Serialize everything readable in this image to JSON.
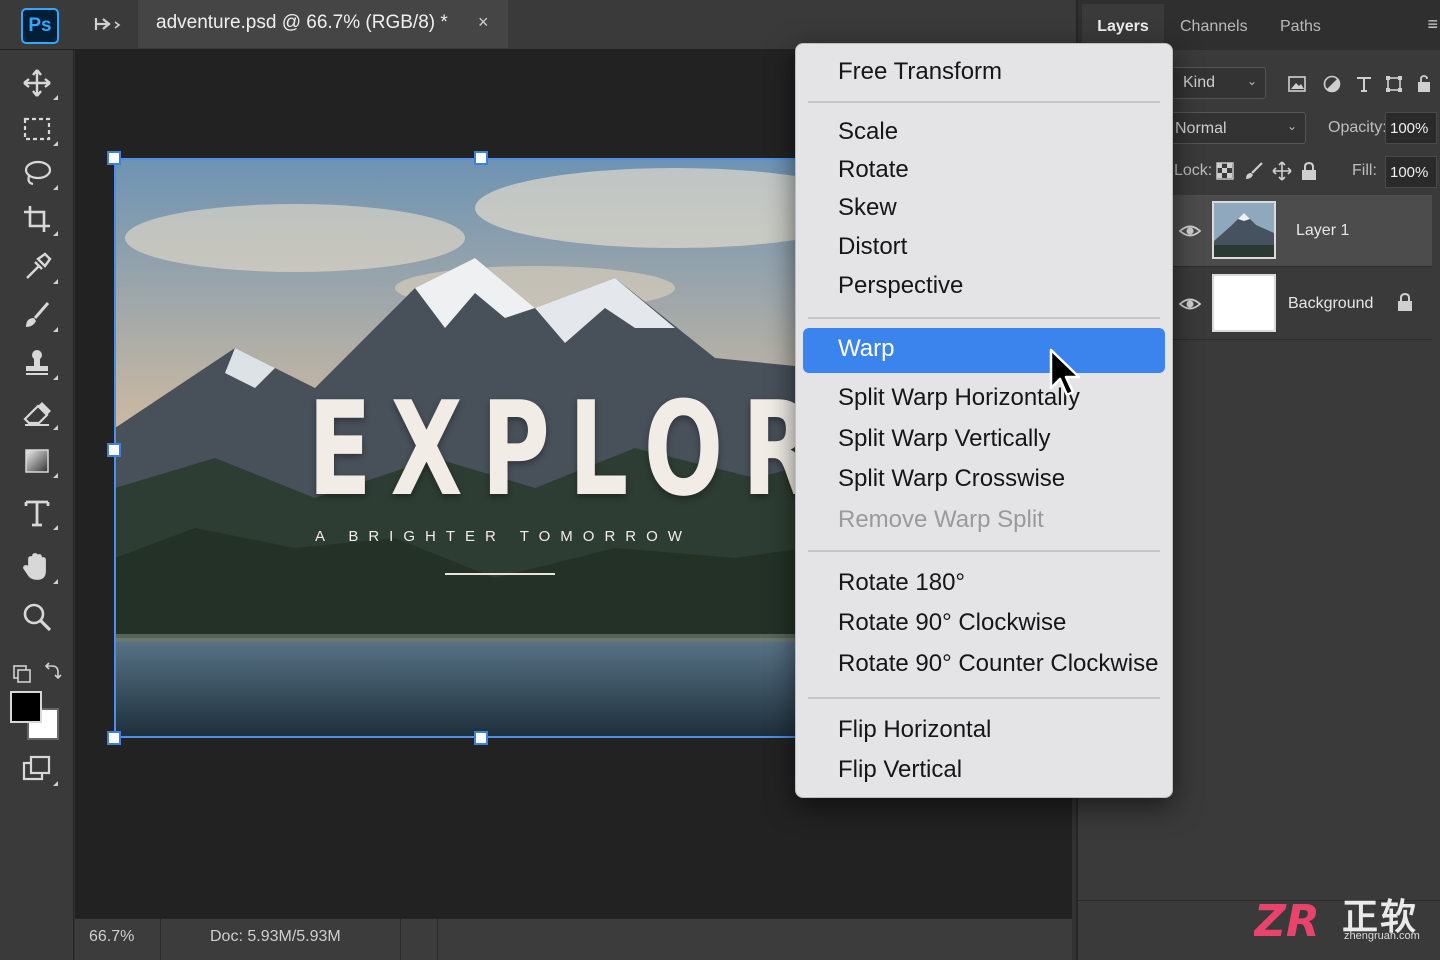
{
  "app": {
    "logo": "Ps"
  },
  "document_tab": {
    "title": "adventure.psd @ 66.7% (RGB/8) *",
    "close_glyph": "×"
  },
  "toolbar": {
    "tools": [
      "move-tool",
      "marquee-tool",
      "lasso-tool",
      "crop-tool",
      "eyedropper-tool",
      "brush-tool",
      "clone-stamp-tool",
      "eraser-tool",
      "gradient-tool",
      "type-tool",
      "hand-tool",
      "zoom-tool"
    ],
    "foreground_color": "#000000",
    "background_color": "#ffffff"
  },
  "canvas": {
    "title": "EXPLORE",
    "subtitle": "A BRIGHTER TOMORROW"
  },
  "status": {
    "zoom": "66.7%",
    "doc": "Doc: 5.93M/5.93M"
  },
  "panel": {
    "tabs": [
      "Layers",
      "Channels",
      "Paths"
    ],
    "filter_kind": "Kind",
    "blend_mode": "Normal",
    "opacity_label": "Opacity:",
    "opacity_value": "100%",
    "lock_label": "Lock:",
    "fill_label": "Fill:",
    "fill_value": "100%",
    "layers": [
      {
        "name": "Layer 1",
        "visible": true,
        "selected": true
      },
      {
        "name": "Background",
        "visible": true,
        "locked": true
      }
    ]
  },
  "context_menu": {
    "groups": [
      [
        "Free Transform"
      ],
      [
        "Scale",
        "Rotate",
        "Skew",
        "Distort",
        "Perspective"
      ],
      [
        "Warp",
        "Split Warp Horizontally",
        "Split Warp Vertically",
        "Split Warp Crosswise",
        "Remove Warp Split"
      ],
      [
        "Rotate 180°",
        "Rotate 90° Clockwise",
        "Rotate 90° Counter Clockwise"
      ],
      [
        "Flip Horizontal",
        "Flip Vertical"
      ]
    ],
    "highlighted": "Warp",
    "disabled": [
      "Remove Warp Split"
    ]
  },
  "watermark": {
    "logo": "ZR",
    "text": "正软",
    "url": "zhengruan.com"
  },
  "colors": {
    "accent": "#3b84ee",
    "selection_box": "#4f8fe6",
    "ps_blue": "#31a8ff"
  }
}
